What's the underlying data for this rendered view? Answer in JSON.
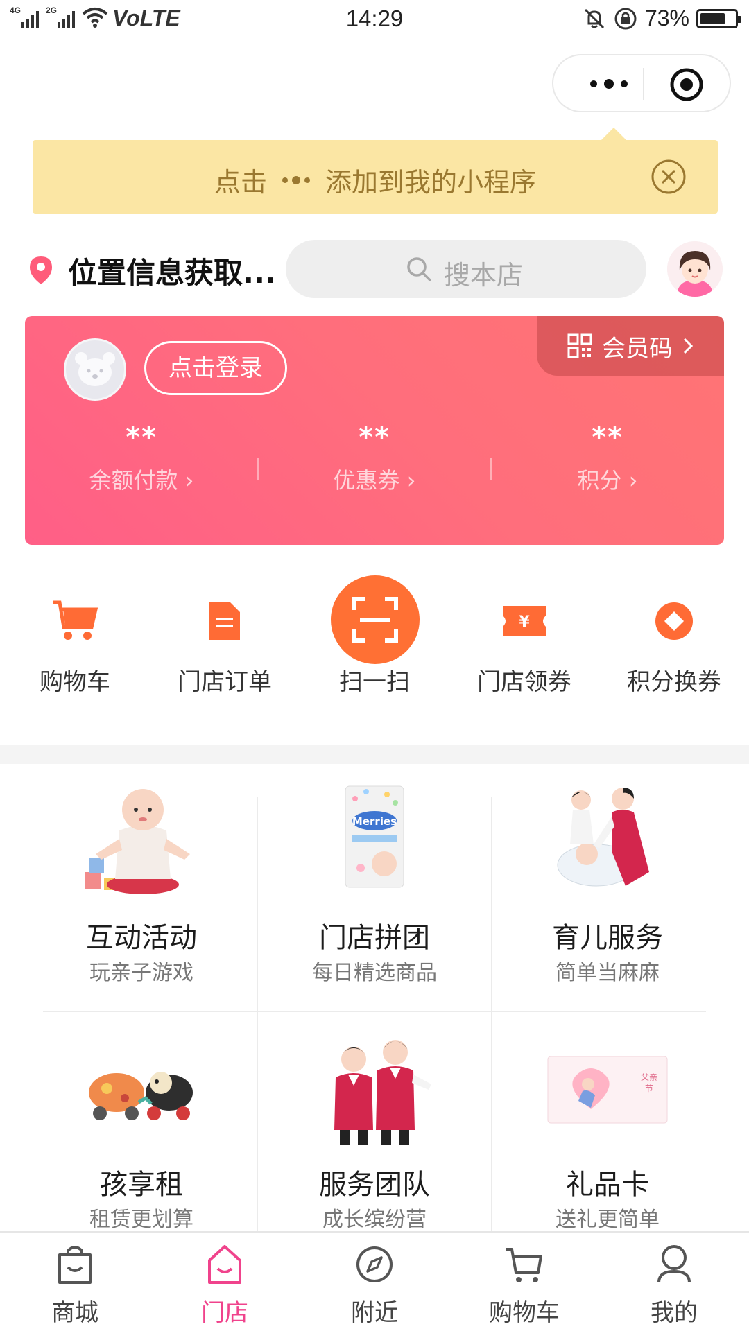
{
  "status_bar": {
    "signal_1": "4G",
    "signal_2": "2G",
    "network": "VoLTE",
    "time": "14:29",
    "battery_pct": "73%",
    "battery_level": 0.73
  },
  "banner": {
    "prefix": "点击",
    "suffix": "添加到我的小程序"
  },
  "header": {
    "location": "位置信息获取...",
    "search_placeholder": "搜本店"
  },
  "member_card": {
    "login_label": "点击登录",
    "member_code_label": "会员码",
    "stats": [
      {
        "value": "**",
        "label": "余额付款"
      },
      {
        "value": "**",
        "label": "优惠券"
      },
      {
        "value": "**",
        "label": "积分"
      }
    ]
  },
  "quick_actions": [
    {
      "label": "购物车",
      "icon": "cart-icon"
    },
    {
      "label": "门店订单",
      "icon": "order-doc-icon"
    },
    {
      "label": "扫一扫",
      "icon": "scan-icon"
    },
    {
      "label": "门店领券",
      "icon": "coupon-ticket-icon"
    },
    {
      "label": "积分换券",
      "icon": "points-diamond-icon"
    }
  ],
  "services": [
    {
      "title": "互动活动",
      "subtitle": "玩亲子游戏"
    },
    {
      "title": "门店拼团",
      "subtitle": "每日精选商品"
    },
    {
      "title": "育儿服务",
      "subtitle": "简单当麻麻"
    },
    {
      "title": "孩享租",
      "subtitle": "租赁更划算"
    },
    {
      "title": "服务团队",
      "subtitle": "成长缤纷营"
    },
    {
      "title": "礼品卡",
      "subtitle": "送礼更简单"
    }
  ],
  "tabbar": {
    "active_index": 1,
    "items": [
      {
        "label": "商城",
        "icon": "shopping-bag-icon"
      },
      {
        "label": "门店",
        "icon": "store-home-icon"
      },
      {
        "label": "附近",
        "icon": "compass-icon"
      },
      {
        "label": "购物车",
        "icon": "cart-outline-icon"
      },
      {
        "label": "我的",
        "icon": "user-icon"
      }
    ]
  },
  "colors": {
    "accent_pink": "#f0438c",
    "accent_orange": "#ff7034",
    "banner_bg": "#fbe6a4",
    "banner_text": "#9a7830"
  }
}
